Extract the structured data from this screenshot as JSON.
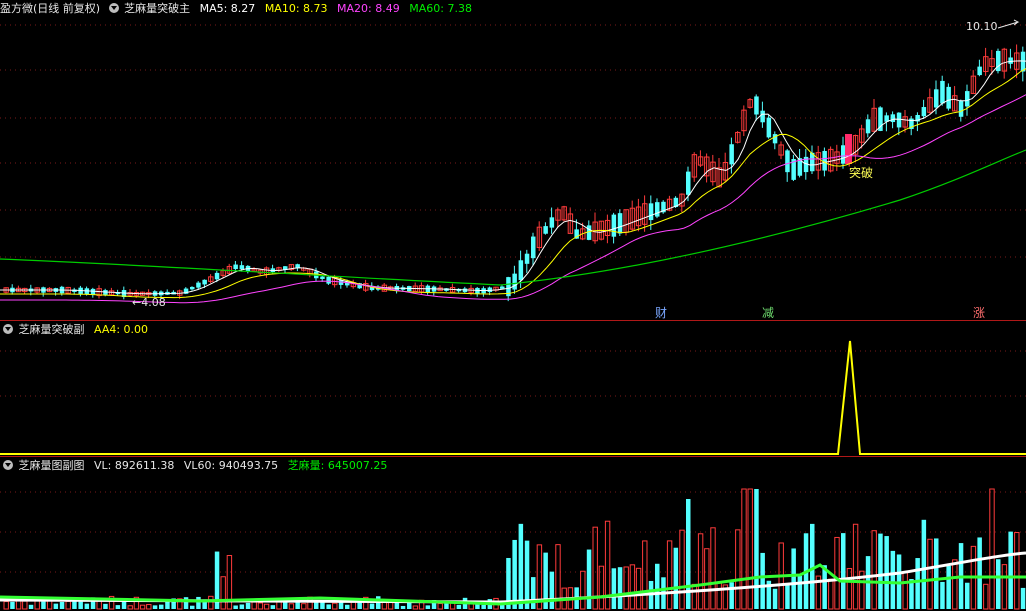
{
  "main": {
    "title": "盈方微(日线 前复权)",
    "indicator": "芝麻量突破主",
    "ma": [
      {
        "label": "MA5: 8.27",
        "color": "#ffffff"
      },
      {
        "label": "MA10: 8.73",
        "color": "#ffff00"
      },
      {
        "label": "MA20: 8.49",
        "color": "#ff44ff"
      },
      {
        "label": "MA60: 7.38",
        "color": "#00ee00"
      }
    ],
    "high_label": "10.10",
    "low_label": "←4.08",
    "breakout_label": "突破",
    "events": [
      {
        "label": "财",
        "color": "#7aa7ff"
      },
      {
        "label": "减",
        "color": "#6fdc6f"
      },
      {
        "label": "涨",
        "color": "#ff6e6e"
      }
    ]
  },
  "sub1": {
    "indicator": "芝麻量突破副",
    "aa4": "AA4: 0.00"
  },
  "sub2": {
    "indicator": "芝麻量图副图",
    "vl": "VL: 892611.38",
    "vl60": "VL60: 940493.75",
    "zml": "芝麻量: 645007.25"
  },
  "colors": {
    "up": "#ff3b3b",
    "down": "#54ffff",
    "ma5": "#ffffff",
    "ma10": "#ffff00",
    "ma20": "#ff44ff",
    "ma60": "#00cc00",
    "separator": "#b01818"
  }
}
